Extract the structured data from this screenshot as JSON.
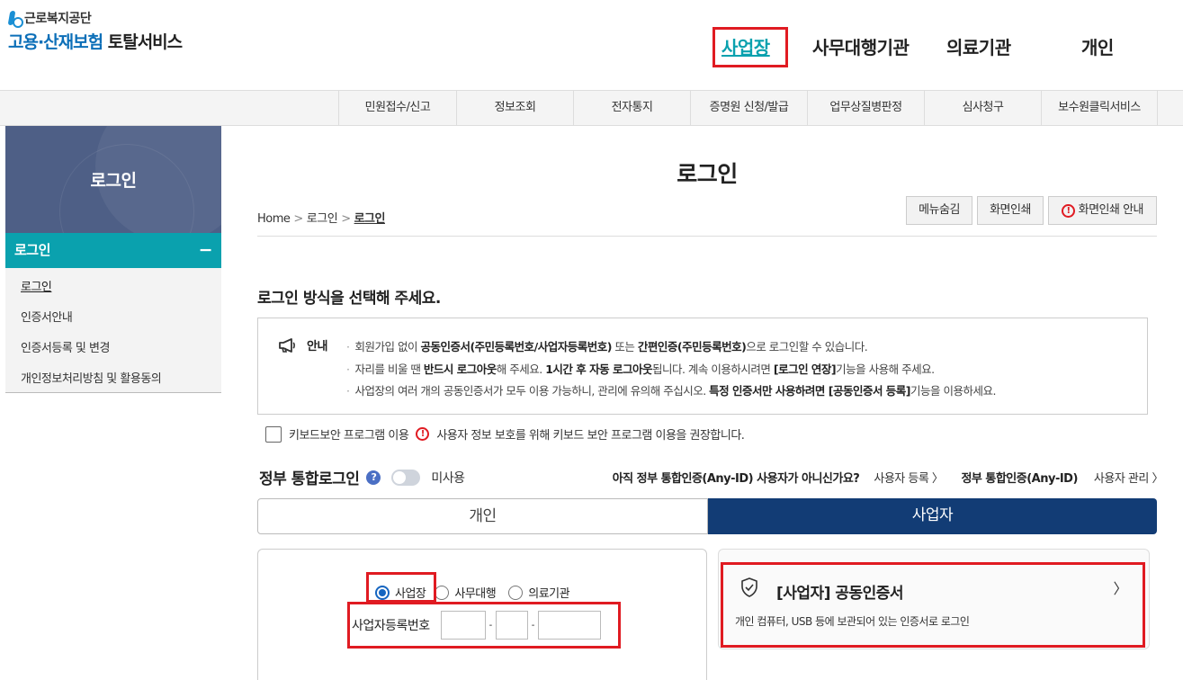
{
  "logo": {
    "org": "근로복지공단",
    "service_part1": "고용·산재보험",
    "service_part2": "토탈서비스"
  },
  "topnav": [
    "사업장",
    "사무대행기관",
    "의료기관",
    "개인"
  ],
  "subnav": [
    "민원접수/신고",
    "정보조회",
    "전자통지",
    "증명원 신청/발급",
    "업무상질병판정",
    "심사청구",
    "보수원클릭서비스"
  ],
  "sidebar": {
    "title": "로그인",
    "section": "로그인",
    "collapse": "−",
    "items": [
      "로그인",
      "인증서안내",
      "인증서등록 및 변경",
      "개인정보처리방침 및 활용동의"
    ]
  },
  "page": {
    "title": "로그인",
    "breadcrumb": [
      "Home",
      "로그인",
      "로그인"
    ],
    "tools": [
      "메뉴숨김",
      "화면인쇄",
      "화면인쇄 안내"
    ],
    "heading": "로그인 방식을 선택해 주세요."
  },
  "notice": {
    "label": "안내",
    "line1": {
      "a": "회원가입 없이 ",
      "b": "공동인증서(주민등록번호/사업자등록번호)",
      "c": " 또는 ",
      "d": "간편인증(주민등록번호)",
      "e": "으로 로그인할 수 있습니다."
    },
    "line2": {
      "a": "자리를 비울 땐 ",
      "b": "반드시 로그아웃",
      "c": "해 주세요. ",
      "d": "1시간 후 자동 로그아웃",
      "e": "됩니다. 계속 이용하시려면 ",
      "f": "[로그인 연장]",
      "g": "기능을 사용해 주세요."
    },
    "line3": {
      "a": "사업장의 여러 개의 공동인증서가 모두 이용 가능하니, 관리에 유의해 주십시오. ",
      "b": "특정 인증서만 사용하려면 [공동인증서 등록]",
      "c": "기능을 이용하세요."
    }
  },
  "keyboard": {
    "label": "키보드보안 프로그램 이용",
    "warning": "사용자 정보 보호를 위해 키보드 보안 프로그램 이용을 권장합니다."
  },
  "gov_login": {
    "title": "정부 통합로그인",
    "help": "?",
    "toggle_state": "미사용",
    "question": "아직 정부 통합인증(Any-ID) 사용자가 아니신가요?",
    "register": "사용자 등록 〉",
    "anyid": "정부 통합인증(Any-ID)",
    "manage": "사용자 관리 〉"
  },
  "tabs": [
    "개인",
    "사업자"
  ],
  "type_radios": {
    "options": [
      "사업장",
      "사무대행",
      "의료기관"
    ],
    "selected": "사업장"
  },
  "brn": {
    "label": "사업자등록번호",
    "dash": "-"
  },
  "cert": {
    "title": "[사업자] 공동인증서",
    "desc": "개인 컴퓨터, USB 등에 보관되어 있는 인증서로 로그인",
    "chevron": "〉"
  }
}
